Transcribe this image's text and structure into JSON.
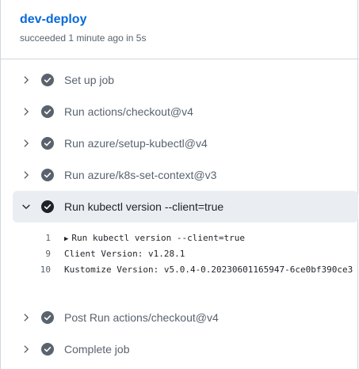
{
  "job": {
    "title": "dev-deploy",
    "status": "succeeded 1 minute ago in 5s"
  },
  "steps": [
    {
      "label": "Set up job",
      "status": "success",
      "expanded": false
    },
    {
      "label": "Run actions/checkout@v4",
      "status": "success",
      "expanded": false
    },
    {
      "label": "Run azure/setup-kubectl@v4",
      "status": "success",
      "expanded": false
    },
    {
      "label": "Run azure/k8s-set-context@v3",
      "status": "success",
      "expanded": false
    },
    {
      "label": "Run kubectl version --client=true",
      "status": "success",
      "expanded": true
    },
    {
      "label": "Post Run actions/checkout@v4",
      "status": "success",
      "expanded": false
    },
    {
      "label": "Complete job",
      "status": "success",
      "expanded": false
    }
  ],
  "log": [
    {
      "line": "1",
      "text": "Run kubectl version --client=true",
      "collapsible": true
    },
    {
      "line": "9",
      "text": "Client Version: v1.28.1",
      "collapsible": false
    },
    {
      "line": "10",
      "text": "Kustomize Version: v5.0.4-0.20230601165947-6ce0bf390ce3",
      "collapsible": false
    }
  ],
  "icons": {
    "chevron_collapsed": "chevron-right-icon",
    "chevron_expanded": "chevron-down-icon",
    "status": "check-circle-icon",
    "log_group": "triangle-right-icon"
  },
  "colors": {
    "link": "#0969da",
    "success_icon_done": "#59636e",
    "success_icon_active": "#1f2328",
    "expanded_bg": "#eaeef2"
  }
}
